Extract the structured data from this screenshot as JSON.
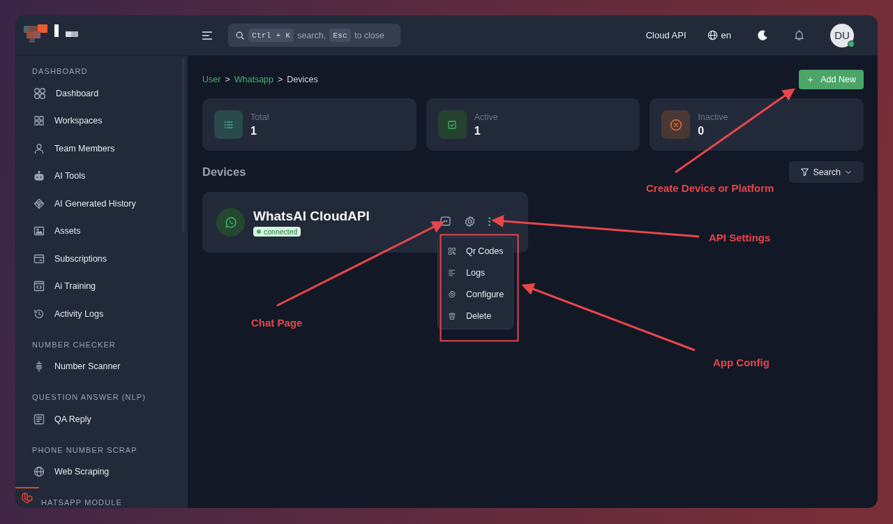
{
  "header": {
    "search": {
      "shortcut_key": "Ctrl + K",
      "text_1": "search,",
      "escape_key": "Esc",
      "text_2": "to close"
    },
    "api_link": "Cloud API",
    "language": "en",
    "avatar": {
      "initials": "DU",
      "online": true
    }
  },
  "sidebar": {
    "sections": [
      {
        "title": "DASHBOARD",
        "items": [
          {
            "label": "Dashboard"
          },
          {
            "label": "Workspaces"
          },
          {
            "label": "Team Members"
          },
          {
            "label": "AI Tools"
          },
          {
            "label": "AI Generated History"
          },
          {
            "label": "Assets"
          },
          {
            "label": "Subscriptions"
          },
          {
            "label": "Ai Training"
          },
          {
            "label": "Activity Logs"
          }
        ]
      },
      {
        "title": "NUMBER CHECKER",
        "items": [
          {
            "label": "Number Scanner"
          }
        ]
      },
      {
        "title": "QUESTION ANSWER (NLP)",
        "items": [
          {
            "label": "QA Reply"
          }
        ]
      },
      {
        "title": "PHONE NUMBER SCRAP",
        "items": [
          {
            "label": "Web Scraping"
          }
        ]
      },
      {
        "title": "HATSAPP MODULE"
      }
    ]
  },
  "breadcrumb": [
    {
      "label": "User",
      "link": true
    },
    {
      "label": "Whatsapp",
      "link": true
    },
    {
      "label": "Devices",
      "link": false
    }
  ],
  "breadcrumb_separator": ">",
  "add_button": "Add New",
  "stats": [
    {
      "label": "Total",
      "value": "1",
      "kind": "total"
    },
    {
      "label": "Active",
      "value": "1",
      "kind": "active"
    },
    {
      "label": "Inactive",
      "value": "0",
      "kind": "inactive"
    }
  ],
  "section_title": "Devices",
  "filter_button": "Search",
  "devices": [
    {
      "name": "WhatsAI CloudAPI",
      "status": "connected",
      "menu_open": true
    }
  ],
  "device_menu": [
    {
      "label": "Qr Codes"
    },
    {
      "label": "Logs"
    },
    {
      "label": "Configure"
    },
    {
      "label": "Delete"
    }
  ],
  "annotations": [
    {
      "label": "Create Device or Platform"
    },
    {
      "label": "API Settings"
    },
    {
      "label": "Chat Page"
    },
    {
      "label": "App Config"
    }
  ]
}
